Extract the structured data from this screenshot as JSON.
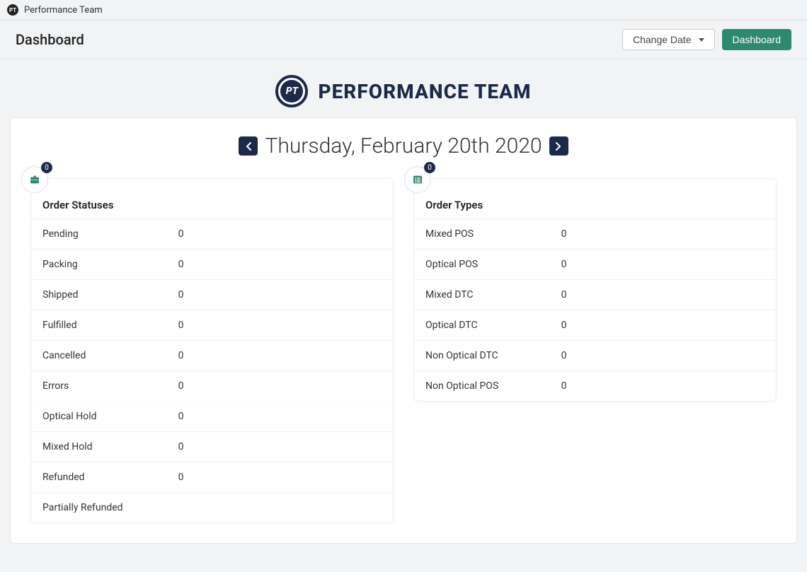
{
  "topbar": {
    "logo_text": "PT",
    "title": "Performance Team"
  },
  "header": {
    "page_title": "Dashboard",
    "change_date_label": "Change Date",
    "dashboard_button_label": "Dashboard"
  },
  "brand": {
    "logo_text": "PT",
    "name": "PERFORMANCE TEAM"
  },
  "date": {
    "display": "Thursday, February 20th 2020"
  },
  "panels": {
    "order_statuses": {
      "badge": "0",
      "title": "Order Statuses",
      "rows": [
        {
          "label": "Pending",
          "value": "0"
        },
        {
          "label": "Packing",
          "value": "0"
        },
        {
          "label": "Shipped",
          "value": "0"
        },
        {
          "label": "Fulfilled",
          "value": "0"
        },
        {
          "label": "Cancelled",
          "value": "0"
        },
        {
          "label": "Errors",
          "value": "0"
        },
        {
          "label": "Optical Hold",
          "value": "0"
        },
        {
          "label": "Mixed Hold",
          "value": "0"
        },
        {
          "label": "Refunded",
          "value": "0"
        },
        {
          "label": "Partially Refunded",
          "value": ""
        }
      ]
    },
    "order_types": {
      "badge": "0",
      "title": "Order Types",
      "rows": [
        {
          "label": "Mixed POS",
          "value": "0"
        },
        {
          "label": "Optical POS",
          "value": "0"
        },
        {
          "label": "Mixed DTC",
          "value": "0"
        },
        {
          "label": "Optical DTC",
          "value": "0"
        },
        {
          "label": "Non Optical DTC",
          "value": "0"
        },
        {
          "label": "Non Optical POS",
          "value": "0"
        }
      ]
    }
  },
  "colors": {
    "navy": "#1c2a4a",
    "green": "#2d8a6e"
  }
}
